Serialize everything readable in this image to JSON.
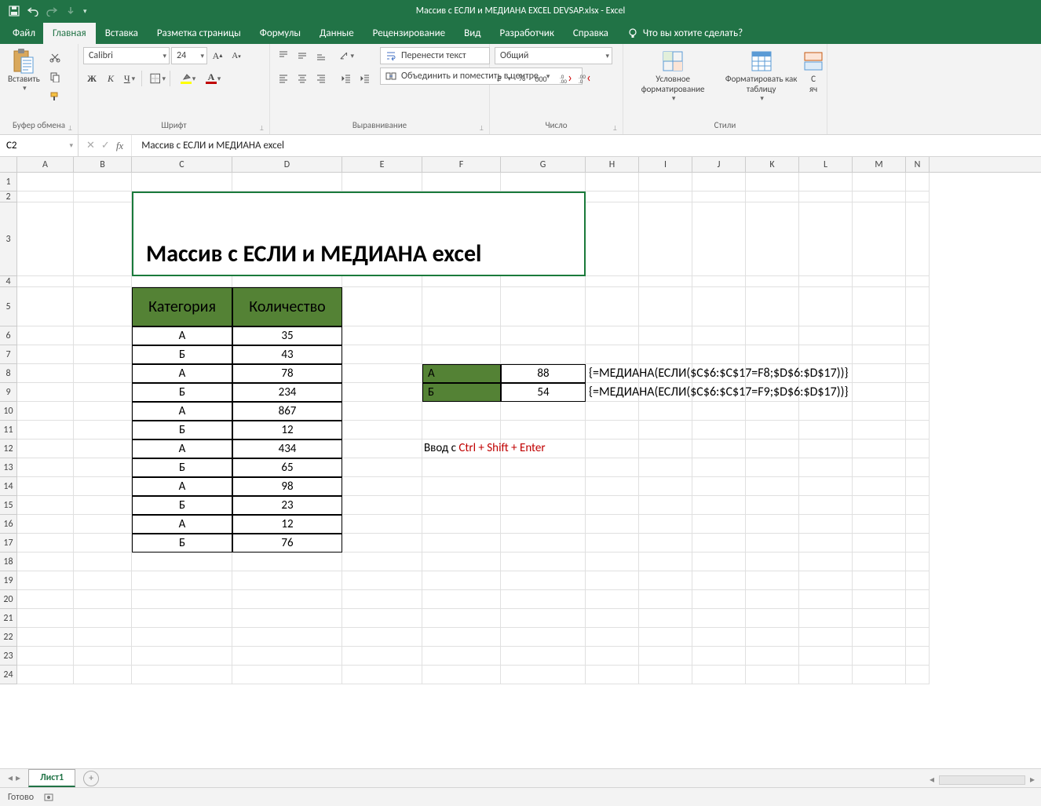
{
  "app": {
    "title": "Массив с ЕСЛИ и МЕДИАНА EXCEL DEVSAP.xlsx  -  Excel"
  },
  "tabs": {
    "file": "Файл",
    "home": "Главная",
    "insert": "Вставка",
    "page_layout": "Разметка страницы",
    "formulas": "Формулы",
    "data": "Данные",
    "review": "Рецензирование",
    "view": "Вид",
    "developer": "Разработчик",
    "help": "Справка",
    "tell_me": "Что вы хотите сделать?"
  },
  "ribbon": {
    "clipboard": {
      "paste": "Вставить",
      "group": "Буфер обмена"
    },
    "font": {
      "group": "Шрифт",
      "name": "Calibri",
      "size": "24",
      "bold": "Ж",
      "italic": "К",
      "underline": "Ч"
    },
    "alignment": {
      "group": "Выравнивание",
      "wrap": "Перенести текст",
      "merge": "Объединить и поместить в центре"
    },
    "number": {
      "group": "Число",
      "format": "Общий",
      "percent": "%",
      "comma": "000"
    },
    "styles": {
      "group": "Стили",
      "conditional": "Условное форматирование",
      "table": "Форматировать как таблицу",
      "cell_styles_1": "С",
      "cell_styles_2": "яч"
    }
  },
  "formula_bar": {
    "name_box": "C2",
    "formula": "Массив с ЕСЛИ и МЕДИАНА excel"
  },
  "columns": [
    "A",
    "B",
    "C",
    "D",
    "E",
    "F",
    "G",
    "H",
    "I",
    "J",
    "K",
    "L",
    "M",
    "N"
  ],
  "rows": [
    "1",
    "2",
    "3",
    "4",
    "5",
    "6",
    "7",
    "8",
    "9",
    "10",
    "11",
    "12",
    "13",
    "14",
    "15",
    "16",
    "17",
    "18",
    "19",
    "20",
    "21",
    "22",
    "23",
    "24"
  ],
  "sheet": {
    "merged_title": "Массив с ЕСЛИ и МЕДИАНА excel",
    "headers": {
      "cat": "Категория",
      "qty": "Количество"
    },
    "data": [
      {
        "cat": "А",
        "qty": "35"
      },
      {
        "cat": "Б",
        "qty": "43"
      },
      {
        "cat": "А",
        "qty": "78"
      },
      {
        "cat": "Б",
        "qty": "234"
      },
      {
        "cat": "А",
        "qty": "867"
      },
      {
        "cat": "Б",
        "qty": "12"
      },
      {
        "cat": "А",
        "qty": "434"
      },
      {
        "cat": "Б",
        "qty": "65"
      },
      {
        "cat": "А",
        "qty": "98"
      },
      {
        "cat": "Б",
        "qty": "23"
      },
      {
        "cat": "А",
        "qty": "12"
      },
      {
        "cat": "Б",
        "qty": "76"
      }
    ],
    "results": [
      {
        "label": "А",
        "value": "88",
        "formula": "{=МЕДИАНА(ЕСЛИ($C$6:$C$17=F8;$D$6:$D$17))}"
      },
      {
        "label": "Б",
        "value": "54",
        "formula": "{=МЕДИАНА(ЕСЛИ($C$6:$C$17=F9;$D$6:$D$17))}"
      }
    ],
    "hint_pre": "Ввод с ",
    "hint_red": "Ctrl + Shift + Enter"
  },
  "sheet_tabs": {
    "sheet1": "Лист1"
  },
  "statusbar": {
    "ready": "Готово"
  }
}
